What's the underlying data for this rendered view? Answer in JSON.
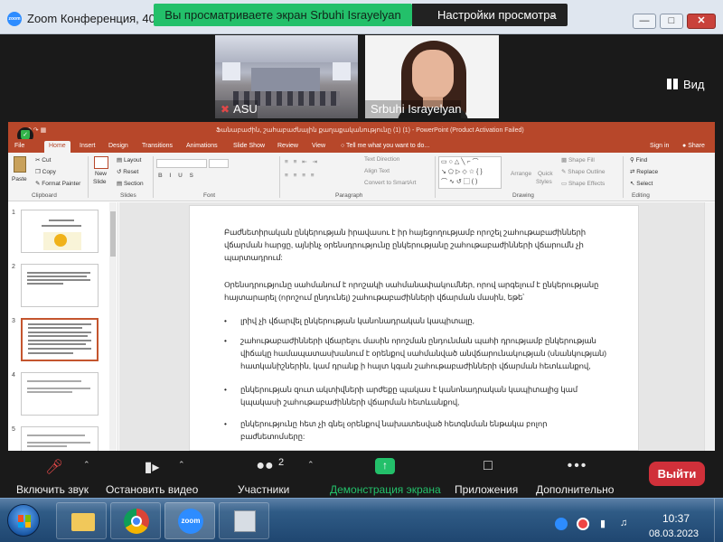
{
  "window": {
    "title": "Zoom Конференция, 40 м...",
    "banner": "Вы просматриваете экран Srbuhi Israyelyan",
    "view_settings": "Настройки просмотра"
  },
  "participants": [
    {
      "name": "ASU",
      "muted": true
    },
    {
      "name": "Srbuhi Israyelyan",
      "muted": false
    }
  ],
  "view_button": "Вид",
  "powerpoint": {
    "doc_title": "Ֆանաբաժին, շահաբաժնային քաղաքականությունը (1) (1) - PowerPoint (Product Activation Failed)",
    "tabs": [
      "File",
      "Home",
      "Insert",
      "Design",
      "Transitions",
      "Animations",
      "Slide Show",
      "Review",
      "View"
    ],
    "tell_me": "Tell me what you want to do...",
    "sign_in": "Sign in",
    "share": "Share",
    "ribbon": {
      "cut": "Cut",
      "copy": "Copy",
      "format_painter": "Format Painter",
      "paste": "Paste",
      "clipboard": "Clipboard",
      "new_slide": "New",
      "new_slide2": "Slide",
      "layout": "Layout",
      "reset": "Reset",
      "section": "Section",
      "slides": "Slides",
      "font": "Font",
      "paragraph": "Paragraph",
      "text_direction": "Text Direction",
      "align_text": "Align Text",
      "convert_smartart": "Convert to SmartArt",
      "arrange": "Arrange",
      "quick_styles": "Quick",
      "quick_styles2": "Styles",
      "shape_fill": "Shape Fill",
      "shape_outline": "Shape Outline",
      "shape_effects": "Shape Effects",
      "drawing": "Drawing",
      "find": "Find",
      "replace": "Replace",
      "select": "Select",
      "editing": "Editing"
    },
    "thumb_numbers": [
      "1",
      "2",
      "3",
      "4",
      "5"
    ],
    "slide": {
      "para1": "Բաժնետիրական ընկերության իրավասու է իր հայեցողությամբ որոշել շահութաբաժինների վճարման հարցը, այնինչ օրենսդրությունը ընկերությանը շահութաբաժինների վճարումն չի պարտադրում:",
      "para2": "Օրենսդրությունը սահմանում է որոշակի սահմանափակումներ, որով արգելում է ընկերությանը հայտարարել (որոշում ընդունել) շահութաբաժինների վճարման մասին, եթե՝",
      "bullets": [
        "լրիվ չի վճարվել ընկերության կանոնադրական կապիտալը,",
        "շահութաբաժինների վճարելու մասին որոշման ընդունման պահի դրությամբ ընկերության վիճակը համապատասխանում է օրենքով սահմանված անվճարունակության (սնանկության) հատկանիշներին, կամ դրանք ի հայտ կգան շահութաբաժինների վճարման հետևանքով,",
        "ընկերության զուտ ակտիվների արժեքը պակաս է կանոնադրական կապիտալից կամ կպակասի շահութաբաժինների վճարման հետևանքով,",
        "ընկերությունը հետ չի գնել օրենքով նախատեսված հետգնման ենթակա բոլոր բաժնետոմսերը:"
      ]
    }
  },
  "controls": {
    "mute": "Включить звук",
    "video": "Остановить видео",
    "participants": "Участники",
    "participants_count": "2",
    "share_screen": "Демонстрация экрана",
    "apps": "Приложения",
    "more": "Дополнительно",
    "leave": "Выйти"
  },
  "taskbar": {
    "zoom_label": "zoom",
    "time": "10:37",
    "date": "08.03.2023"
  },
  "colors": {
    "zoom_bg": "#1a1a1a",
    "share_green": "#23c06a",
    "ppt_red": "#b7472a",
    "leave_red": "#d0303a"
  }
}
